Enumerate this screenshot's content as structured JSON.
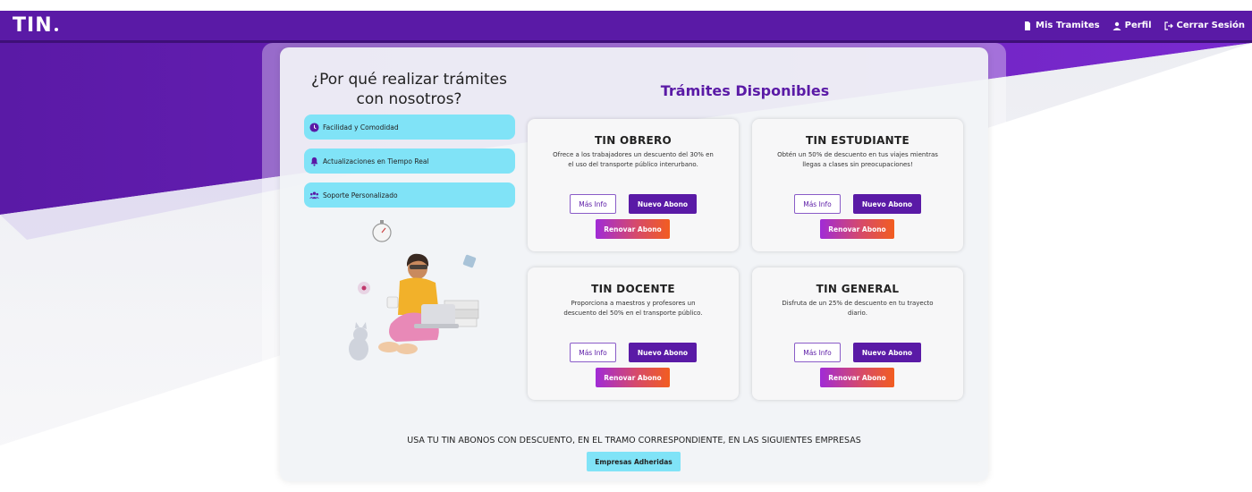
{
  "navbar": {
    "logo": "TIN",
    "links": [
      {
        "label": "Mis Tramites",
        "icon": "document-icon"
      },
      {
        "label": "Perfil",
        "icon": "user-icon"
      },
      {
        "label": "Cerrar Sesión",
        "icon": "logout-icon"
      }
    ]
  },
  "left": {
    "title_line1": "¿Por qué realizar trámites",
    "title_line2": "con nosotros?",
    "features": [
      {
        "label": "Facilidad y Comodidad",
        "icon": "clock-icon"
      },
      {
        "label": "Actualizaciones en Tiempo Real",
        "icon": "bell-icon"
      },
      {
        "label": "Soporte Personalizado",
        "icon": "users-icon"
      }
    ]
  },
  "tramites": {
    "title": "Trámites Disponibles",
    "cards": [
      {
        "title": "TIN OBRERO",
        "desc_line1": "Ofrece a los trabajadores un descuento del 30% en",
        "desc_line2": "el uso del transporte público interurbano.",
        "info": "Más Info",
        "nuevo": "Nuevo Abono",
        "renovar": "Renovar Abono"
      },
      {
        "title": "TIN ESTUDIANTE",
        "desc_line1": "Obtén un 50% de descuento en tus viajes mientras",
        "desc_line2": "llegas a clases sin preocupaciones!",
        "info": "Más Info",
        "nuevo": "Nuevo Abono",
        "renovar": "Renovar Abono"
      },
      {
        "title": "TIN DOCENTE",
        "desc_line1": "Proporciona a maestros y profesores un",
        "desc_line2": "descuento del 50% en el transporte público.",
        "info": "Más Info",
        "nuevo": "Nuevo Abono",
        "renovar": "Renovar Abono"
      },
      {
        "title": "TIN GENERAL",
        "desc_line1": "Disfruta de un 25% de descuento en tu trayecto",
        "desc_line2": "diario.",
        "info": "Más Info",
        "nuevo": "Nuevo Abono",
        "renovar": "Renovar Abono"
      }
    ]
  },
  "footer": {
    "text": "USA TU TIN ABONOS CON DESCUENTO, EN EL TRAMO CORRESPONDIENTE, EN LAS SIGUIENTES EMPRESAS",
    "button": "Empresas Adheridas"
  },
  "colors": {
    "brand_purple": "#5a1aa6",
    "accent_cyan": "#80e3f7",
    "gradient_start": "#a02bd6",
    "gradient_end": "#f25d20"
  }
}
